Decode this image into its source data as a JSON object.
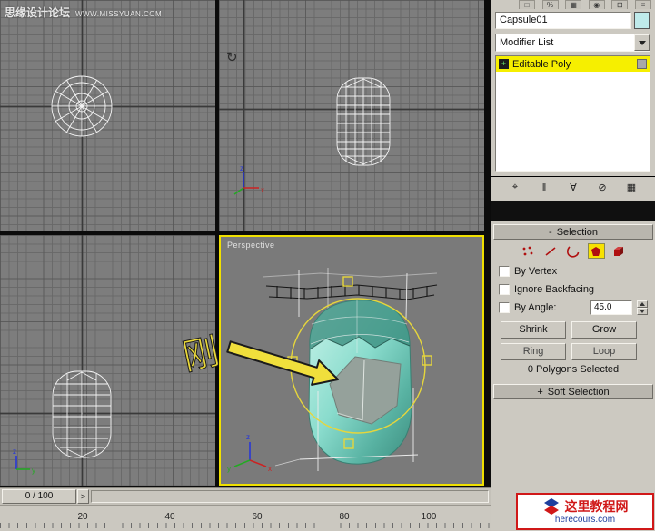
{
  "watermark": {
    "site": "思缘设计论坛",
    "url": "WWW.MISSYUAN.COM"
  },
  "main_toolbar": {
    "icons": [
      "□",
      "%",
      "▦",
      "◉",
      "⊞",
      "≡"
    ]
  },
  "viewports": {
    "perspective_label": "Perspective",
    "annotation": "刚",
    "axes": {
      "x": "x",
      "y": "y",
      "z": "z"
    },
    "rotate_view_glyph": "↻"
  },
  "icons": {
    "modifier_list_arrow": "chevron-down",
    "spinner": "triangle-up-down",
    "rotate_view": "arc-rotate-icon",
    "subobject_modes": [
      "vertex",
      "edge",
      "border",
      "polygon",
      "element"
    ]
  },
  "command_panel": {
    "object_name": "Capsule01",
    "modifier_list_label": "Modifier List",
    "stack": {
      "expand_glyph": "+",
      "item": "Editable Poly"
    },
    "stack_toolbar": [
      {
        "name": "pin-stack",
        "glyph": "⌖"
      },
      {
        "name": "show-end-result",
        "glyph": "‖"
      },
      {
        "name": "make-unique",
        "glyph": "∀"
      },
      {
        "name": "remove-modifier",
        "glyph": "⊘"
      },
      {
        "name": "configure-modifier-sets",
        "glyph": "▦"
      }
    ],
    "selection": {
      "collapse_glyph": "-",
      "title": "Selection",
      "active_mode": "polygon",
      "by_vertex_label": "By Vertex",
      "ignore_backfacing_label": "Ignore Backfacing",
      "by_angle_label": "By Angle:",
      "angle_value": "45.0",
      "shrink_label": "Shrink",
      "grow_label": "Grow",
      "ring_label": "Ring",
      "loop_label": "Loop",
      "status": "0 Polygons Selected"
    },
    "soft_selection": {
      "expand_glyph": "+",
      "title": "Soft Selection"
    }
  },
  "timeline": {
    "frame_display": "0 / 100",
    "next_glyph": ">",
    "ticks": [
      "20",
      "40",
      "60",
      "80",
      "100"
    ]
  },
  "logo": {
    "title": "这里教程网",
    "url": "herecours.com"
  },
  "colors": {
    "active_viewport_border": "#f0e000",
    "stack_highlight": "#f6ef00",
    "object_color": "#bfeaea",
    "gizmo_yellow": "#e6d63c",
    "subobject_red": "#b01010"
  }
}
